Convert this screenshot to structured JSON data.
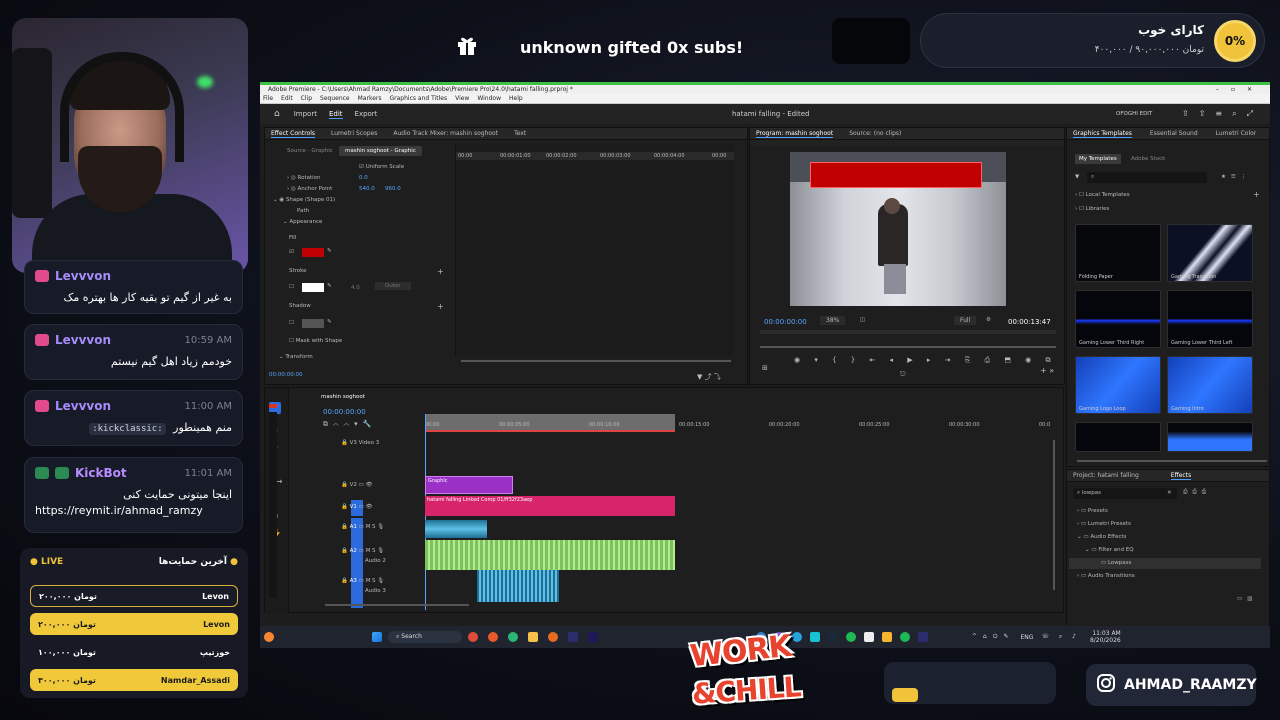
{
  "gift": {
    "text": "unknown gifted 0x subs!"
  },
  "goal": {
    "title": "کارای خوب",
    "amount": "تومان ۹۰,۰۰۰,۰۰۰ / ۴۰۰,۰۰۰",
    "percent": "0%"
  },
  "chat": [
    {
      "user": "Levvvon",
      "time": "",
      "msg": "به غیر از گیم تو بقیه کار ها بهتره مک"
    },
    {
      "user": "Levvvon",
      "time": "10:59 AM",
      "msg": "خودمم زیاد اهل گیم نیستم"
    },
    {
      "user": "Levvvon",
      "time": "11:00 AM",
      "emote": ":kickclassic:",
      "msg": "منم همینطور"
    },
    {
      "user": "KickBot",
      "time": "11:01 AM",
      "msg": "اینجا میتونی حمایت کنی",
      "link": "https://reymit.ir/ahmad_ramzy"
    }
  ],
  "supporters": {
    "live": "LIVE",
    "title": "آخرین حمایت‌ها",
    "items": [
      {
        "name": "Levon",
        "amount": "۲۰۰,۰۰۰ تومان"
      },
      {
        "name": "Levon",
        "amount": "۲۰۰,۰۰۰ تومان"
      },
      {
        "name": "خوزتیپ",
        "amount": "۱۰۰,۰۰۰ تومان"
      },
      {
        "name": "Namdar_Assadi",
        "amount": "۳۰۰,۰۰۰ تومان"
      }
    ]
  },
  "premiere": {
    "title": "Adobe Premiere - C:\\Users\\Ahmad Ramzy\\Documents\\Adobe\\Premiere Pro\\24.0\\hatami falling.prproj *",
    "menu": [
      "File",
      "Edit",
      "Clip",
      "Sequence",
      "Markers",
      "Graphics and Titles",
      "View",
      "Window",
      "Help"
    ],
    "workspace_tabs": [
      "Import",
      "Edit",
      "Export"
    ],
    "doc_title": "hatami falling - Edited",
    "user": "OFOGHI EDIT",
    "effect_tabs": [
      "Effect Controls",
      "Lumetri Scopes",
      "Audio Track Mixer: mashin soghoot",
      "Text"
    ],
    "source_label": "Source - Graphic",
    "seq_label": "mashin soghoot - Graphic",
    "uniform_scale": "Uniform Scale",
    "rotation": {
      "label": "Rotation",
      "value": "0.0"
    },
    "anchor": {
      "label": "Anchor Point",
      "x": "540.0",
      "y": "960.0"
    },
    "shape": "Shape (Shape 01)",
    "path": "Path",
    "appearance": "Appearance",
    "fill": "Fill",
    "stroke": "Stroke",
    "stroke_width": "4.0",
    "stroke_pos": "Outer",
    "shadow": "Shadow",
    "mask": "Mask with Shape",
    "transform": "Transform",
    "ec_time": "00:00:00:00",
    "ec_ruler": [
      "00:00",
      "00:00:01:00",
      "00:00:02:00",
      "00:00:03:00",
      "00:00:04:00",
      "00:00"
    ],
    "program_tab": "Program: mashin soghoot",
    "source_tab": "Source: (no clips)",
    "prog_time": "00:00:00:00",
    "zoom": "38%",
    "quality": "Full",
    "duration": "00:00:13:47",
    "gt_tabs": [
      "Graphics Templates",
      "Essential Sound",
      "Lumetri Color"
    ],
    "my_templates": "My Templates",
    "adobe_stock": "Adobe Stock",
    "local_templates": "Local Templates",
    "libraries": "Libraries",
    "templates": [
      "Folding Paper",
      "Gaming Transition",
      "Gaming Lower Third Right",
      "Gaming Lower Third Left",
      "Gaming Logo Loop",
      "Gaming Intro"
    ],
    "project_tab": "Project: hatami falling",
    "effects_tab": "Effects",
    "effects_search": "lowpas",
    "effects_tree": [
      "Presets",
      "Lumetri Presets",
      "Audio Effects",
      "Filter and EQ",
      "Lowpass",
      "Audio Transitions"
    ],
    "seq_name": "mashin soghoot",
    "tl_time": "00:00:00:00",
    "tl_ruler": [
      "00:00",
      "00:00:05:00",
      "00:00:10:00",
      "00:00:15:00",
      "00:00:20:00",
      "00:00:25:00",
      "00:00:30:00",
      "00:0"
    ],
    "tracks": [
      "Video 3",
      "V2",
      "V1",
      "A1",
      "A2",
      "Audio 2",
      "A3",
      "Audio 3"
    ],
    "clip_graphic": "Graphic",
    "clip_video": "hatami falling Linked Comp 01/ff32f23aep"
  },
  "taskbar": {
    "search": "Search",
    "lang": "ENG",
    "time": "11:03 AM",
    "date": "8/20/2026"
  },
  "logo": {
    "line1": "WORK",
    "line2": "&CHILL"
  },
  "instagram": {
    "handle": "AHMAD_RAAMZY"
  },
  "colors": {
    "accent_gold": "#f1c33a",
    "premiere_green": "#3fbf47",
    "fill_red": "#c00000",
    "clip_pink": "#d8246b",
    "clip_purple": "#9b30c6",
    "audio_green": "#8bd66b"
  }
}
